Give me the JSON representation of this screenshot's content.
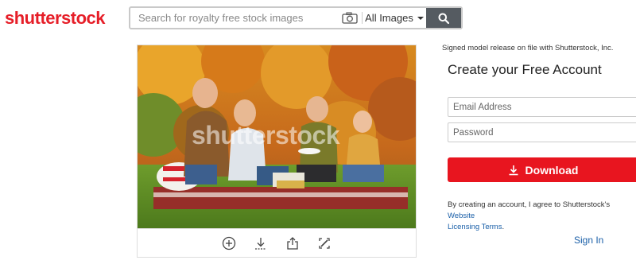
{
  "header": {
    "logo_text": "shutterstock",
    "search": {
      "placeholder": "Search for royalty free stock images",
      "category_label": "All Images"
    }
  },
  "image_viewer": {
    "watermark_text": "shutterstock",
    "toolbar_icons": [
      "add-to-lightbox-icon",
      "download-icon",
      "share-icon",
      "edit-icon"
    ]
  },
  "signup": {
    "release_note": "Signed model release on file with Shutterstock, Inc.",
    "heading": "Create your Free Account",
    "email_placeholder": "Email Address",
    "password_placeholder": "Password",
    "download_label": "Download",
    "terms_prefix": "By creating an account, I agree to Shutterstock's ",
    "terms_link_1": "Website",
    "terms_link_2": "Licensing Terms",
    "terms_suffix": ".",
    "signin_label": "Sign In"
  },
  "colors": {
    "brand_red": "#e61e28",
    "download_red": "#e8151f",
    "link_blue": "#1a5fa8",
    "search_button": "#555b61"
  }
}
